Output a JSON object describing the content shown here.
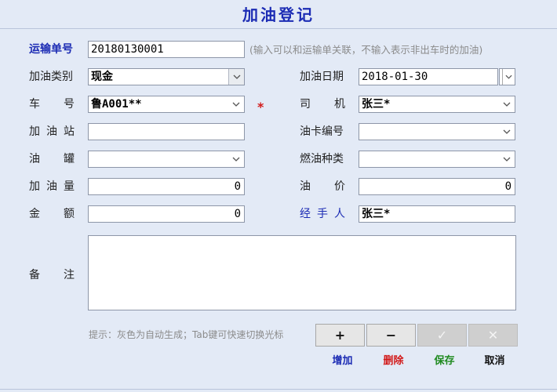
{
  "header": {
    "title": "加油登记"
  },
  "form": {
    "waybill": {
      "label": "运输单号",
      "value": "20180130001",
      "hint": "(输入可以和运输单关联，不输入表示非出车时的加油)"
    },
    "category": {
      "label": "加油类别",
      "value": "现金"
    },
    "date": {
      "label": "加油日期",
      "value": "2018-01-30"
    },
    "vehicle": {
      "label_chars": [
        "车",
        "号"
      ],
      "value": "鲁A001**",
      "required_mark": "*"
    },
    "driver": {
      "label_chars": [
        "司",
        "机"
      ],
      "value": "张三*"
    },
    "station": {
      "label_chars": [
        "加",
        "油",
        "站"
      ],
      "value": ""
    },
    "card_no": {
      "label": "油卡编号",
      "value": ""
    },
    "tank": {
      "label_chars": [
        "油",
        "罐"
      ],
      "value": ""
    },
    "fuel_type": {
      "label": "燃油种类",
      "value": ""
    },
    "quantity": {
      "label_chars": [
        "加",
        "油",
        "量"
      ],
      "value": "0"
    },
    "price": {
      "label_chars": [
        "油",
        "价"
      ],
      "value": "0"
    },
    "amount": {
      "label_chars": [
        "金",
        "额"
      ],
      "value": "0"
    },
    "handler": {
      "label_chars": [
        "经",
        "手",
        "人"
      ],
      "value": "张三*"
    },
    "remark": {
      "label_chars": [
        "备",
        "注"
      ],
      "value": ""
    }
  },
  "tip": "提示：灰色为自动生成；Tab键可快速切换光标",
  "toolbar": {
    "add": {
      "icon": "+",
      "label": "增加",
      "color": "#1c2cb4"
    },
    "delete": {
      "icon": "−",
      "label": "删除",
      "color": "#d21a1a"
    },
    "save": {
      "icon": "✓",
      "label": "保存",
      "color": "#1f8a1f"
    },
    "cancel": {
      "icon": "✕",
      "label": "取消",
      "color": "#111111"
    }
  }
}
